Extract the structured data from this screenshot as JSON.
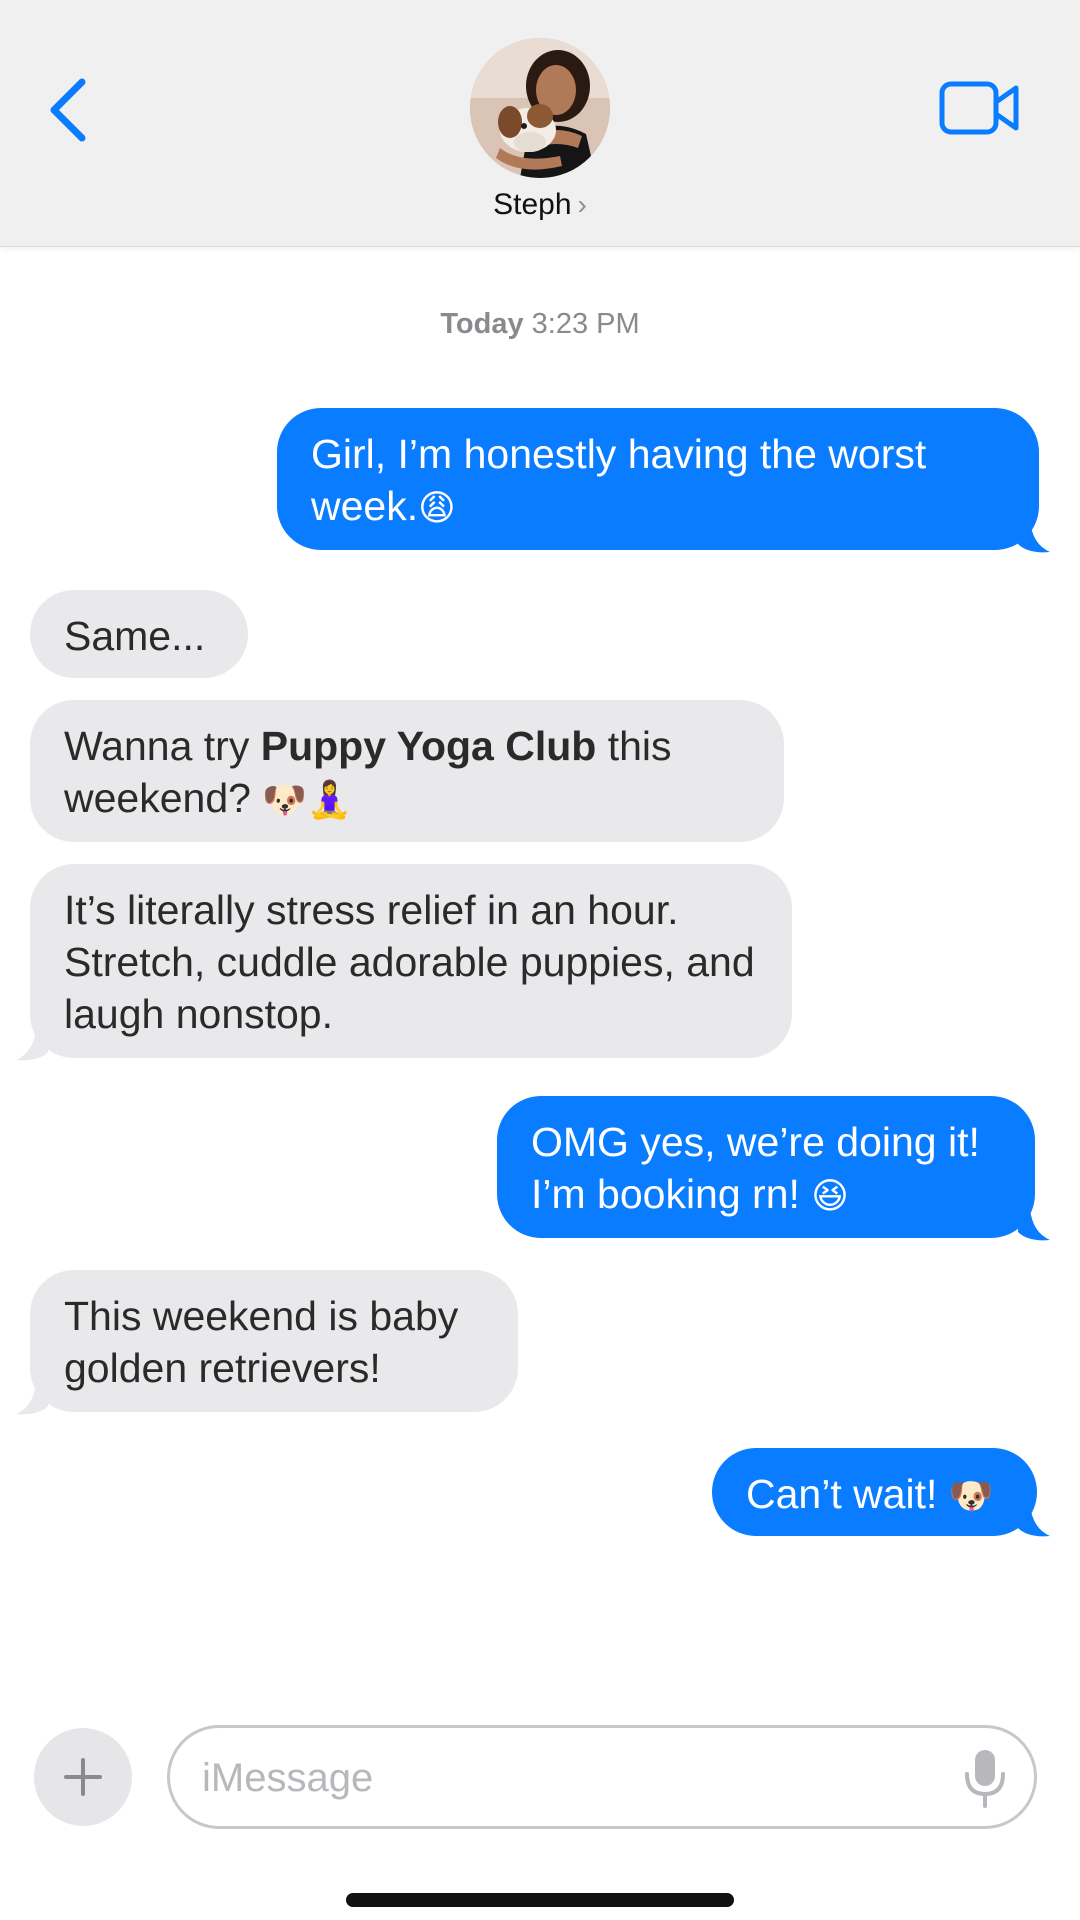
{
  "header": {
    "contact_name": "Steph",
    "chevron": "›",
    "icons": {
      "back": "chevron-left-icon",
      "video": "video-camera-icon"
    }
  },
  "thread": {
    "timestamp_day": "Today",
    "timestamp_time": "3:23 PM",
    "messages": [
      {
        "direction": "outgoing",
        "text": "Girl, I’m honestly having the worst week.",
        "emoji": "😩"
      },
      {
        "direction": "incoming",
        "text": "Same..."
      },
      {
        "direction": "incoming",
        "text_before": "Wanna try ",
        "text_bold": "Puppy Yoga Club",
        "text_after": " this weekend? ",
        "emoji": "🐶🧘‍♀️"
      },
      {
        "direction": "incoming",
        "text": "It’s literally stress relief in an hour. Stretch, cuddle adorable puppies, and laugh nonstop."
      },
      {
        "direction": "outgoing",
        "text_line1": "OMG yes, we’re doing it!",
        "text_line2": "I’m booking rn! ",
        "emoji": "😆"
      },
      {
        "direction": "incoming",
        "text": "This weekend is baby golden retrievers!"
      },
      {
        "direction": "outgoing",
        "text": "Can’t wait! ",
        "emoji": "🐶"
      }
    ]
  },
  "composer": {
    "placeholder": "iMessage",
    "value": "",
    "icons": {
      "add": "plus-icon",
      "mic": "microphone-icon"
    }
  },
  "colors": {
    "outgoing_bubble": "#0a7cff",
    "incoming_bubble": "#e9e9eb",
    "accent": "#0a7cff",
    "header_bg": "#f0f0f0"
  }
}
